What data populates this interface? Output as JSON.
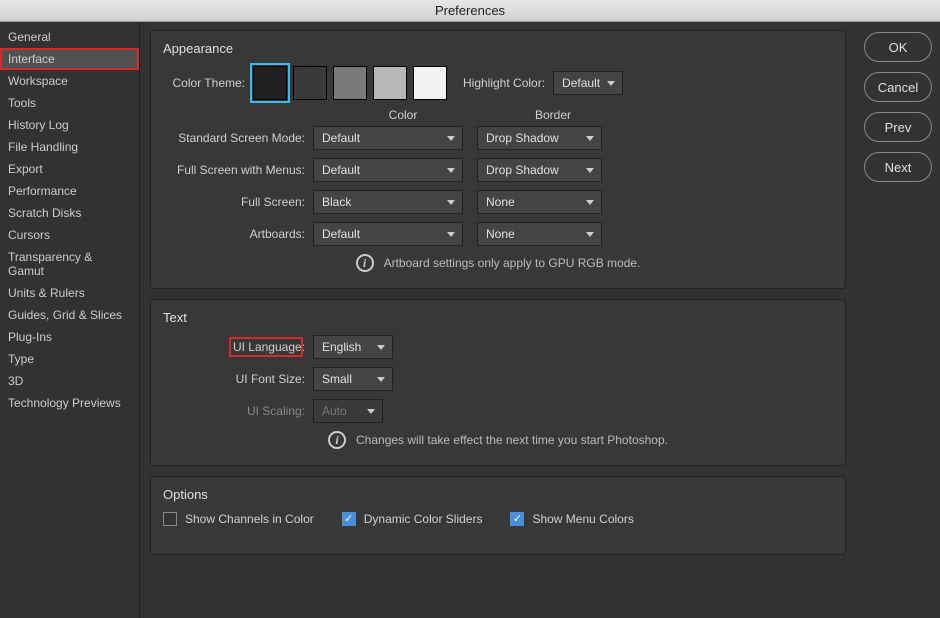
{
  "title": "Preferences",
  "sidebar": {
    "items": [
      {
        "label": "General"
      },
      {
        "label": "Interface",
        "active": true,
        "highlight": true
      },
      {
        "label": "Workspace"
      },
      {
        "label": "Tools"
      },
      {
        "label": "History Log"
      },
      {
        "label": "File Handling"
      },
      {
        "label": "Export"
      },
      {
        "label": "Performance"
      },
      {
        "label": "Scratch Disks"
      },
      {
        "label": "Cursors"
      },
      {
        "label": "Transparency & Gamut"
      },
      {
        "label": "Units & Rulers"
      },
      {
        "label": "Guides, Grid & Slices"
      },
      {
        "label": "Plug-Ins"
      },
      {
        "label": "Type"
      },
      {
        "label": "3D"
      },
      {
        "label": "Technology Previews"
      }
    ]
  },
  "buttons": {
    "ok": "OK",
    "cancel": "Cancel",
    "prev": "Prev",
    "next": "Next"
  },
  "appearance": {
    "title": "Appearance",
    "color_theme_label": "Color Theme:",
    "swatches": [
      "#1f1f1f",
      "#3a3a3a",
      "#7a7a7a",
      "#b8b8b8",
      "#f2f2f2"
    ],
    "selected_swatch": 0,
    "highlight_label": "Highlight Color:",
    "highlight_value": "Default",
    "col_color": "Color",
    "col_border": "Border",
    "rows": [
      {
        "label": "Standard Screen Mode:",
        "color": "Default",
        "border": "Drop Shadow"
      },
      {
        "label": "Full Screen with Menus:",
        "color": "Default",
        "border": "Drop Shadow"
      },
      {
        "label": "Full Screen:",
        "color": "Black",
        "border": "None"
      },
      {
        "label": "Artboards:",
        "color": "Default",
        "border": "None"
      }
    ],
    "info": "Artboard settings only apply to GPU RGB mode."
  },
  "text": {
    "title": "Text",
    "ui_language_label": "UI Language:",
    "ui_language_value": "English",
    "ui_language_highlight": true,
    "ui_font_label": "UI Font Size:",
    "ui_font_value": "Small",
    "ui_scaling_label": "UI Scaling:",
    "ui_scaling_value": "Auto",
    "info": "Changes will take effect the next time you start Photoshop."
  },
  "options": {
    "title": "Options",
    "items": [
      {
        "label": "Show Channels in Color",
        "checked": false
      },
      {
        "label": "Dynamic Color Sliders",
        "checked": true
      },
      {
        "label": "Show Menu Colors",
        "checked": true
      }
    ]
  }
}
